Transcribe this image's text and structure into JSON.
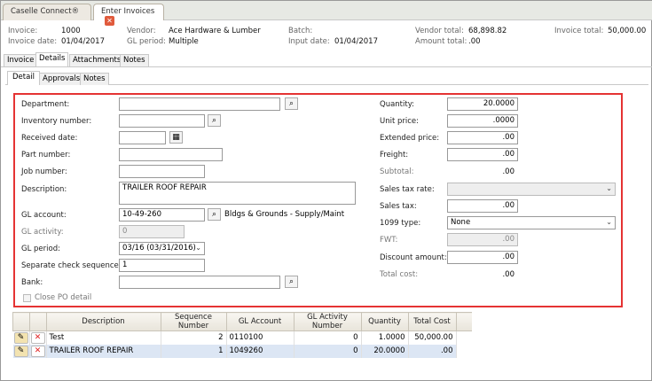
{
  "tabs": [
    {
      "label": "Caselle Connect®"
    },
    {
      "label": "Enter Invoices"
    }
  ],
  "header": {
    "invoice_label": "Invoice:",
    "invoice": "1000",
    "invoice_date_label": "Invoice date:",
    "invoice_date": "01/04/2017",
    "vendor_label": "Vendor:",
    "vendor": "Ace Hardware & Lumber",
    "gl_period_label": "GL period:",
    "gl_period": "Multiple",
    "batch_label": "Batch:",
    "batch": "",
    "input_date_label": "Input date:",
    "input_date": "01/04/2017",
    "vendor_total_label": "Vendor total:",
    "vendor_total": "68,898.82",
    "amount_total_label": "Amount total:",
    "amount_total": ".00",
    "invoice_total_label": "Invoice total:",
    "invoice_total": "50,000.00"
  },
  "main_tabs": [
    "Invoice",
    "Details",
    "Attachments",
    "Notes"
  ],
  "sub_tabs": [
    "Detail",
    "Approvals",
    "Notes"
  ],
  "form": {
    "department": {
      "label": "Department:",
      "value": ""
    },
    "inventory": {
      "label": "Inventory number:",
      "value": ""
    },
    "received": {
      "label": "Received date:",
      "value": ""
    },
    "part": {
      "label": "Part number:",
      "value": ""
    },
    "job": {
      "label": "Job number:",
      "value": ""
    },
    "description": {
      "label": "Description:",
      "value": "TRAILER ROOF REPAIR"
    },
    "gl_account": {
      "label": "GL account:",
      "value": "10-49-260",
      "desc": "Bldgs & Grounds - Supply/Maint"
    },
    "gl_activity": {
      "label": "GL activity:",
      "value": "0"
    },
    "gl_period": {
      "label": "GL period:",
      "value": "03/16 (03/31/2016)"
    },
    "sep_check": {
      "label": "Separate check sequence:",
      "value": "1"
    },
    "bank": {
      "label": "Bank:",
      "value": ""
    },
    "close_po": {
      "label": "Close PO detail",
      "checked": false
    },
    "quantity": {
      "label": "Quantity:",
      "value": "20.0000"
    },
    "unit_price": {
      "label": "Unit price:",
      "value": ".0000"
    },
    "extended": {
      "label": "Extended price:",
      "value": ".00"
    },
    "freight": {
      "label": "Freight:",
      "value": ".00"
    },
    "subtotal": {
      "label": "Subtotal:",
      "value": ".00"
    },
    "sales_tax_rate": {
      "label": "Sales tax rate:",
      "value": ""
    },
    "sales_tax": {
      "label": "Sales tax:",
      "value": ".00"
    },
    "type1099": {
      "label": "1099 type:",
      "value": "None"
    },
    "fwt": {
      "label": "FWT:",
      "value": ".00"
    },
    "discount": {
      "label": "Discount amount:",
      "value": ".00"
    },
    "total_cost": {
      "label": "Total cost:",
      "value": ".00"
    }
  },
  "grid": {
    "columns": [
      "Description",
      "Sequence Number",
      "GL Account",
      "GL Activity Number",
      "Quantity",
      "Total Cost"
    ],
    "rows": [
      [
        "Test",
        "2",
        "0110100",
        "0",
        "1.0000",
        "50,000.00"
      ],
      [
        "TRAILER ROOF REPAIR",
        "1",
        "1049260",
        "0",
        "20.0000",
        ".00"
      ]
    ]
  },
  "colors": {
    "highlight_border": "#e53333",
    "selected_row": "#dce6f4"
  }
}
